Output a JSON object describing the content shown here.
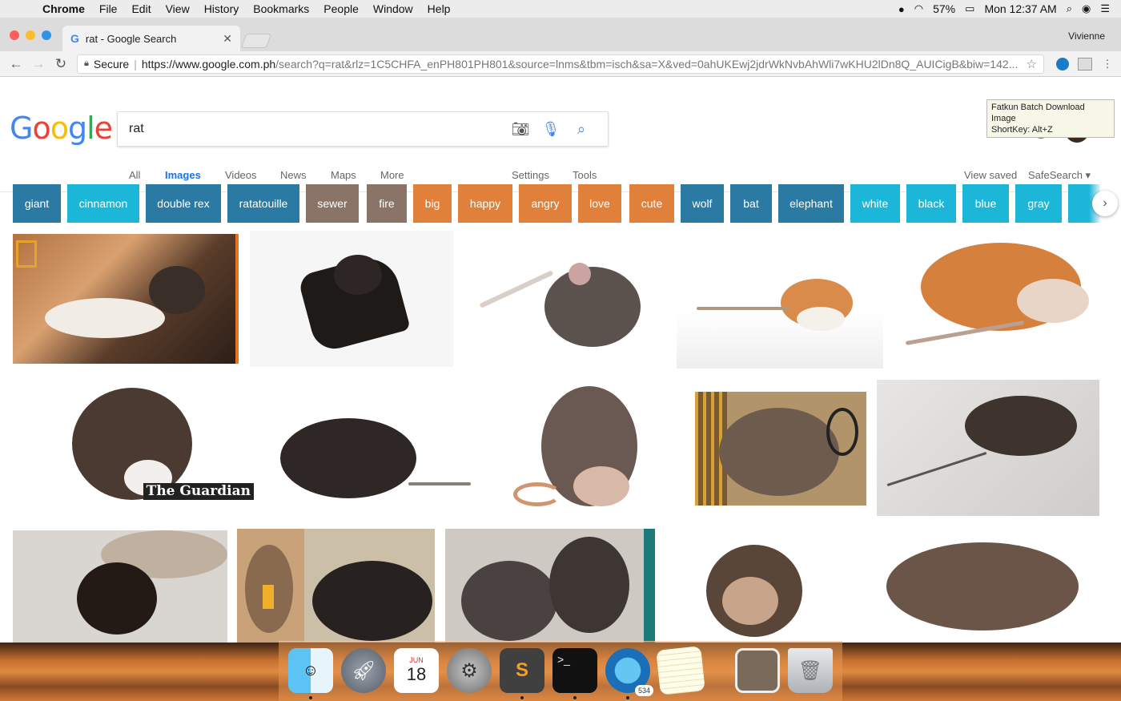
{
  "menubar": {
    "app": "Chrome",
    "items": [
      "File",
      "Edit",
      "View",
      "History",
      "Bookmarks",
      "People",
      "Window",
      "Help"
    ],
    "battery": "57%",
    "clock": "Mon 12:37 AM"
  },
  "browser": {
    "tab_title": "rat - Google Search",
    "tab_favicon": "G",
    "profile": "Vivienne",
    "secure_label": "Secure",
    "url_host": "https://www.google.com.ph",
    "url_path": "/search?q=rat&rlz=1C5CHFA_enPH801PH801&source=lnms&tbm=isch&sa=X&ved=0ahUKEwj2jdrWkNvbAhWli7wKHU2lDn8Q_AUICigB&biw=142...",
    "tooltip_line1": "Fatkun Batch Download Image",
    "tooltip_line2": "ShortKey: Alt+Z"
  },
  "google": {
    "query": "rat",
    "tabs": [
      "All",
      "Images",
      "Videos",
      "News",
      "Maps",
      "More",
      "Settings",
      "Tools"
    ],
    "active_tab": "Images",
    "view_saved": "View saved",
    "safesearch": "SafeSearch ▾",
    "logo_colors": [
      "#4285F4",
      "#EA4335",
      "#FBBC05",
      "#4285F4",
      "#34A853",
      "#EA4335"
    ]
  },
  "chips": [
    {
      "label": "giant",
      "color": "#2b7aa3"
    },
    {
      "label": "cinnamon",
      "color": "#1bb6d8"
    },
    {
      "label": "double rex",
      "color": "#2b7aa3"
    },
    {
      "label": "ratatouille",
      "color": "#2b7aa3"
    },
    {
      "label": "sewer",
      "color": "#8a7467"
    },
    {
      "label": "fire",
      "color": "#8a7467"
    },
    {
      "label": "big",
      "color": "#e0803a"
    },
    {
      "label": "happy",
      "color": "#e0803a"
    },
    {
      "label": "angry",
      "color": "#e0803a"
    },
    {
      "label": "love",
      "color": "#e0803a"
    },
    {
      "label": "cute",
      "color": "#e0803a"
    },
    {
      "label": "wolf",
      "color": "#2b7aa3"
    },
    {
      "label": "bat",
      "color": "#2b7aa3"
    },
    {
      "label": "elephant",
      "color": "#2b7aa3"
    },
    {
      "label": "white",
      "color": "#1bb6d8"
    },
    {
      "label": "black",
      "color": "#1bb6d8"
    },
    {
      "label": "blue",
      "color": "#1bb6d8"
    },
    {
      "label": "gray",
      "color": "#1bb6d8"
    }
  ],
  "results": {
    "watermark": "The Guardian"
  },
  "dock": {
    "calendar_month": "JUN",
    "calendar_day": "18",
    "badge": "534",
    "apps": [
      "finder",
      "launchpad",
      "calendar",
      "system-preferences",
      "sublime-text",
      "terminal",
      "chrome",
      "notes",
      "preview",
      "trash"
    ]
  }
}
